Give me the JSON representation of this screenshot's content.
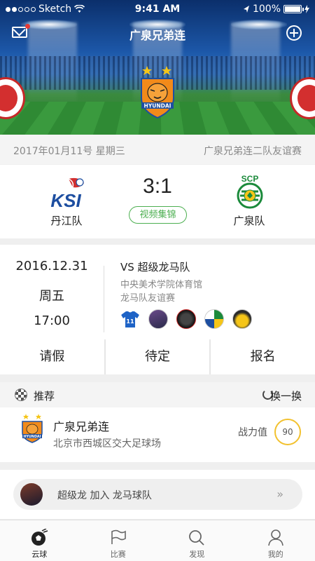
{
  "status_bar": {
    "carrier": "Sketch",
    "time": "9:41 AM",
    "battery": "100%"
  },
  "header": {
    "title": "广泉兄弟连",
    "team_logo_text": "HYUNDAI"
  },
  "match_info": {
    "date": "2017年01月11号 星期三",
    "event_name": "广泉兄弟连二队友谊赛",
    "home_team": "丹江队",
    "away_team": "广泉队",
    "home_logo_text": "KSI",
    "away_logo_text": "SCP",
    "score": "3:1",
    "video_label": "视频集锦"
  },
  "event": {
    "date": "2016.12.31",
    "weekday": "周五",
    "time": "17:00",
    "title": "VS 超级龙马队",
    "venue": "中央美术学院体育馆",
    "type": "龙马队友谊赛",
    "jersey_number": "11"
  },
  "actions": {
    "leave": "请假",
    "pending": "待定",
    "signup": "报名"
  },
  "recommend": {
    "title": "推荐",
    "refresh_label": "换一换",
    "team_name": "广泉兄弟连",
    "address": "北京市西城区交大足球场",
    "power_label": "战力值",
    "power_value": "90"
  },
  "notice": {
    "text": "超级龙 加入 龙马球队"
  },
  "tabs": [
    {
      "label": "云球",
      "active": true
    },
    {
      "label": "比赛",
      "active": false
    },
    {
      "label": "发现",
      "active": false
    },
    {
      "label": "我的",
      "active": false
    }
  ],
  "colors": {
    "accent_green": "#4caf50",
    "power_ring": "#f2c12e",
    "notification_dot": "#e53935"
  }
}
